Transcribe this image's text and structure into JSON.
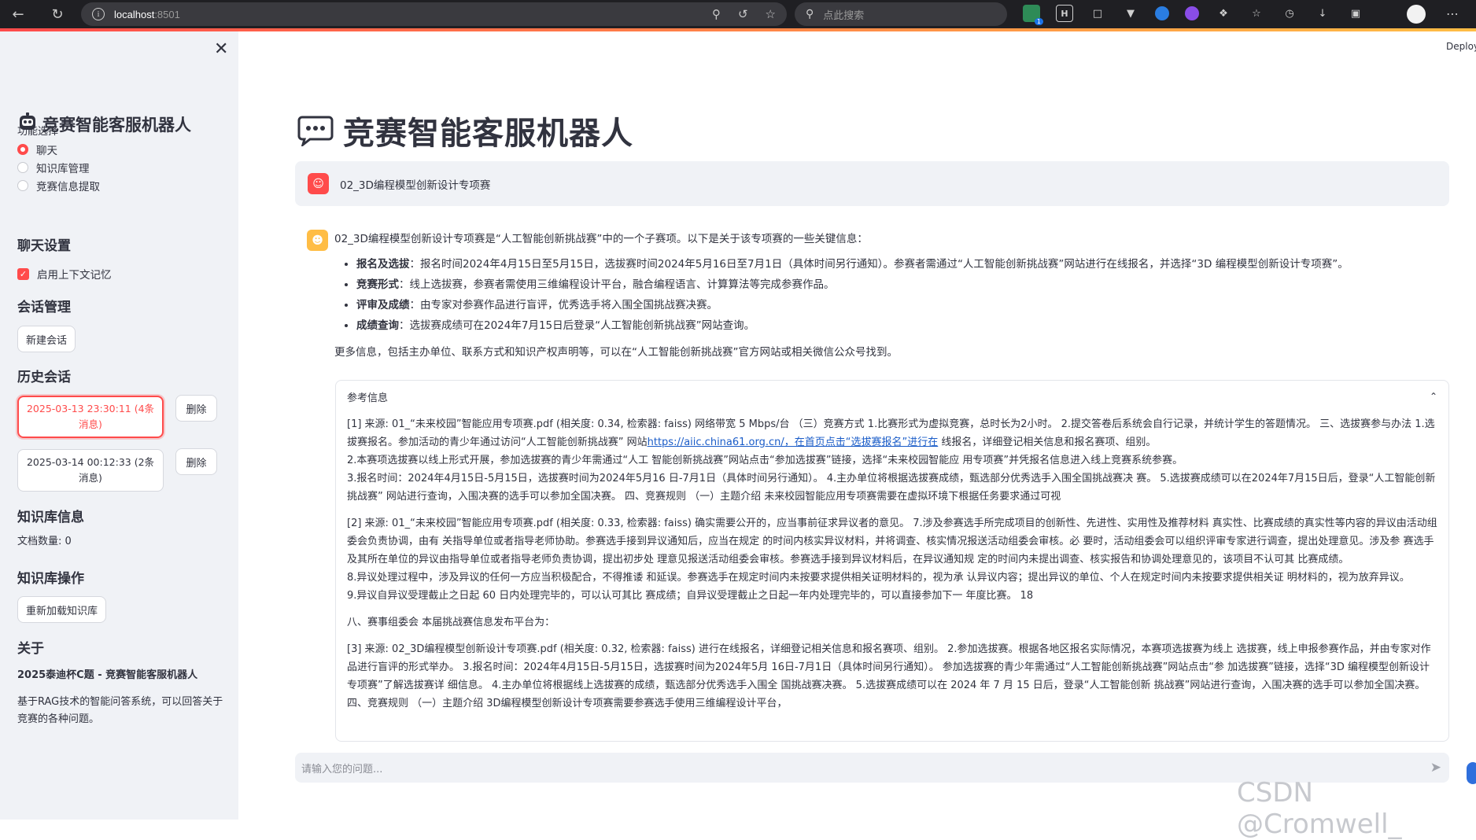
{
  "browser": {
    "url_host": "localhost",
    "url_port": ":8501",
    "search_placeholder": "点此搜索",
    "ext_badge": "1"
  },
  "sidebar": {
    "title": "竞赛智能客服机器人",
    "function_label": "功能选择",
    "radios": [
      {
        "label": "聊天",
        "selected": true
      },
      {
        "label": "知识库管理",
        "selected": false
      },
      {
        "label": "竞赛信息提取",
        "selected": false
      }
    ],
    "chat_settings_heading": "聊天设置",
    "context_memory_label": "启用上下文记忆",
    "session_mgmt_heading": "会话管理",
    "new_session_label": "新建会话",
    "history_heading": "历史会话",
    "history": [
      {
        "label": "2025-03-13 23:30:11 (4条消息)",
        "active": true
      },
      {
        "label": "2025-03-14 00:12:33 (2条消息)",
        "active": false
      }
    ],
    "delete_label": "删除",
    "kb_info_heading": "知识库信息",
    "doc_count": "文档数量: 0",
    "kb_ops_heading": "知识库操作",
    "reload_kb_label": "重新加载知识库",
    "about_heading": "关于",
    "about_title": "2025泰迪杯C题 - 竞赛智能客服机器人",
    "about_text": "基于RAG技术的智能问答系统，可以回答关于竞赛的各种问题。"
  },
  "main": {
    "deploy_label": "Deploy",
    "title": "竞赛智能客服机器人",
    "user_message": "02_3D编程模型创新设计专项赛",
    "bot_intro": "02_3D编程模型创新设计专项赛是“人工智能创新挑战赛”中的一个子赛项。以下是关于该专项赛的一些关键信息：",
    "bullets": [
      {
        "key": "报名及选拔",
        "text": "：报名时间2024年4月15日至5月15日，选拔赛时间2024年5月16日至7月1日（具体时间另行通知）。参赛者需通过“人工智能创新挑战赛”网站进行在线报名，并选择“3D 编程模型创新设计专项赛”。"
      },
      {
        "key": "竞赛形式",
        "text": "：线上选拔赛，参赛者需使用三维编程设计平台，融合编程语言、计算算法等完成参赛作品。"
      },
      {
        "key": "评审及成绩",
        "text": "：由专家对参赛作品进行盲评，优秀选手将入围全国挑战赛决赛。"
      },
      {
        "key": "成绩查询",
        "text": "：选拔赛成绩可在2024年7月15日后登录“人工智能创新挑战赛”网站查询。"
      }
    ],
    "bot_more": "更多信息，包括主办单位、联系方式和知识产权声明等，可以在“人工智能创新挑战赛”官方网站或相关微信公众号找到。",
    "ref_heading": "参考信息",
    "ref1_a": "[1] 来源: 01_“未来校园”智能应用专项赛.pdf (相关度: 0.34, 检索器: faiss) 网络带宽 5 Mbps/台 （三）竞赛方式 1.比赛形式为虚拟竞赛，总时长为2小时。 2.提交答卷后系统会自行记录，并统计学生的答题情况。 三、选拔赛参与办法 1.选拔赛报名。参加活动的青少年通过访问“人工智能创新挑战赛” 网站",
    "ref1_link": "https://aiic.china61.org.cn/，在首页点击“选拔赛报名”进行在",
    "ref1_b": " 线报名，详细登记相关信息和报名赛项、组别。",
    "ref1_c": "2.本赛项选拔赛以线上形式开展，参加选拔赛的青少年需通过“人工 智能创新挑战赛”网站点击“参加选拔赛”链接，选择“未来校园智能应 用专项赛”并凭报名信息进入线上竞赛系统参赛。",
    "ref1_d": "3.报名时间：2024年4月15日-5月15日，选拔赛时间为2024年5月16 日-7月1日（具体时间另行通知）。 4.主办单位将根据选拔赛成绩，甄选部分优秀选手入围全国挑战赛决 赛。 5.选拔赛成绩可以在2024年7月15日后，登录“人工智能创新挑战赛” 网站进行查询，入围决赛的选手可以参加全国决赛。 四、竞赛规则 （一）主题介绍 未来校园智能应用专项赛需要在虚拟环境下根据任务要求通过可视",
    "ref2_a": "[2] 来源: 01_“未来校园”智能应用专项赛.pdf (相关度: 0.33, 检索器: faiss) 确实需要公开的，应当事前征求异议者的意见。 7.涉及参赛选手所完成项目的创新性、先进性、实用性及推荐材料 真实性、比赛成绩的真实性等内容的异议由活动组委会负责协调，由有 关指导单位或者指导老师协助。参赛选手接到异议通知后，应当在规定 的时间内核实异议材料，并将调查、核实情况报送活动组委会审核。必 要时，活动组委会可以组织评审专家进行调查，提出处理意见。涉及参 赛选手及其所在单位的异议由指导单位或者指导老师负责协调，提出初步处 理意见报送活动组委会审核。参赛选手接到异议材料后，在异议通知规 定的时间内未提出调查、核实报告和协调处理意见的，该项目不认可其 比赛成绩。",
    "ref2_b": "8.异议处理过程中，涉及异议的任何一方应当积极配合，不得推诿 和延误。参赛选手在规定时间内未按要求提供相关证明材料的，视为承 认异议内容；提出异议的单位、个人在规定时间内未按要求提供相关证 明材料的，视为放弃异议。",
    "ref2_c": "9.异议自异议受理截止之日起 60 日内处理完毕的，可以认可其比 赛成绩；自异议受理截止之日起一年内处理完毕的，可以直接参加下一 年度比赛。 18",
    "ref2_d": "八、赛事组委会 本届挑战赛信息发布平台为：",
    "ref3_a": "[3] 来源: 02_3D编程模型创新设计专项赛.pdf (相关度: 0.32, 检索器: faiss) 进行在线报名，详细登记相关信息和报名赛项、组别。 2.参加选拔赛。根据各地区报名实际情况，本赛项选拔赛为线上 选拔赛，线上申报参赛作品，并由专家对作品进行盲评的形式举办。 3.报名时间：2024年4月15日-5月15日，选拔赛时间为2024年5月 16日-7月1日（具体时间另行通知）。 参加选拔赛的青少年需通过“人工智能创新挑战赛”网站点击“参 加选拔赛”链接，选择“3D 编程模型创新设计专项赛”了解选拔赛详 细信息。 4.主办单位将根据线上选拔赛的成绩，甄选部分优秀选手入围全 国挑战赛决赛。 5.选拔赛成绩可以在 2024 年 7 月 15 日后，登录“人工智能创新 挑战赛”网站进行查询，入围决赛的选手可以参加全国决赛。 四、竞赛规则 （一）主题介绍 3D编程模型创新设计专项赛需要参赛选手使用三维编程设计平台，",
    "input_placeholder": "请输入您的问题...",
    "watermark": "CSDN @Cromwell_"
  },
  "colors": {
    "accent": "#ff4b4b",
    "bot_avatar": "#ffbd45",
    "sidebar_bg": "#f0f2f6",
    "link": "#1a5cc8"
  }
}
